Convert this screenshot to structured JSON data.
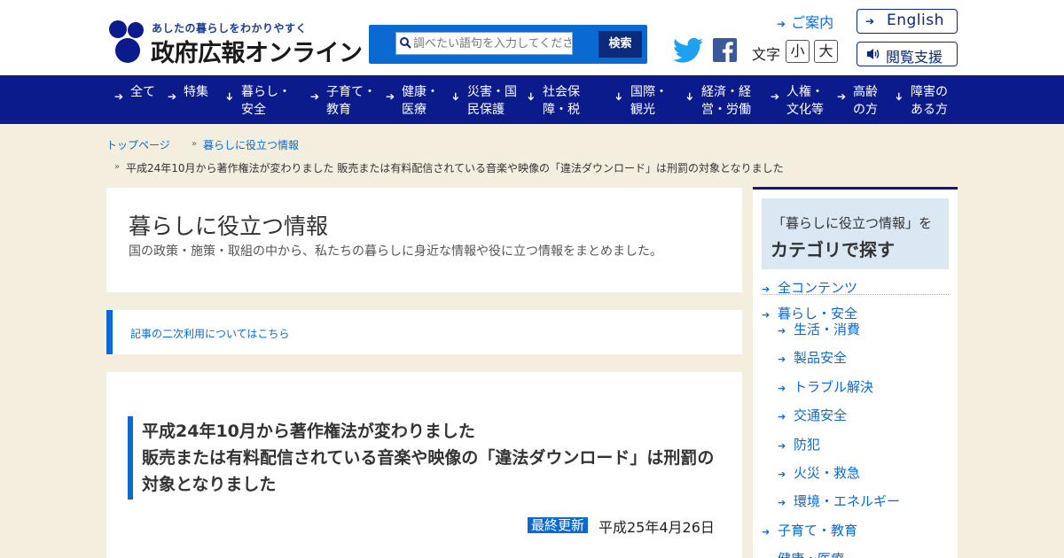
{
  "header": {
    "logo_tagline": "あしたの暮らしをわかりやすく",
    "logo_name": "政府広報オンライン",
    "search_placeholder": "調べたい語句を入力してください",
    "search_button": "検索",
    "guide_link": "ご案内",
    "font_size_label": "文字",
    "font_small": "小",
    "font_large": "大",
    "english_button": "English",
    "accessibility_button": "閲覧支援"
  },
  "nav": {
    "items": [
      {
        "label": "全て"
      },
      {
        "label": "特集"
      },
      {
        "label": "暮らし・\n安全"
      },
      {
        "label": "子育て・\n教育"
      },
      {
        "label": "健康・\n医療"
      },
      {
        "label": "災害・国\n民保護"
      },
      {
        "label": "社会保\n障・税"
      },
      {
        "label": "国際・\n観光"
      },
      {
        "label": "経済・経\n営・労働"
      },
      {
        "label": "人権・\n文化等"
      },
      {
        "label": "高齢\nの方"
      },
      {
        "label": "障害の\nある方"
      }
    ]
  },
  "breadcrumb": {
    "home": "トップページ",
    "section": "暮らしに役立つ情報",
    "current": "平成24年10月から著作権法が変わりました 販売または有料配信されている音楽や映像の「違法ダウンロード」は刑罰の対象となりました"
  },
  "main": {
    "section_title": "暮らしに役立つ情報",
    "section_desc": "国の政策・施策・取組の中から、私たちの暮らしに身近な情報や役に立つ情報をまとめました。",
    "reuse_link": "記事の二次利用についてはこちら",
    "article_title_lines": [
      "平成24年10月から著作権法が変わりました",
      "販売または有料配信されている音楽や映像の「違法ダウンロード」は刑罰の",
      "対象となりました"
    ],
    "updated_label": "最終更新",
    "updated_date": "平成25年4月26日"
  },
  "sidebar": {
    "head_line1": "「暮らしに役立つ情報」を",
    "head_line2": "カテゴリで探す",
    "all": "全コンテンツ",
    "category": "暮らし・安全",
    "subitems": [
      "生活・消費",
      "製品安全",
      "トラブル解決",
      "交通安全",
      "防犯",
      "火災・救急",
      "環境・エネルギー"
    ],
    "next1": "子育て・教育",
    "next2": "健康・医療"
  },
  "colors": {
    "nav_bg": "#0c1b8c",
    "accent": "#0b6ad1",
    "page_bg": "#f3eedd"
  }
}
